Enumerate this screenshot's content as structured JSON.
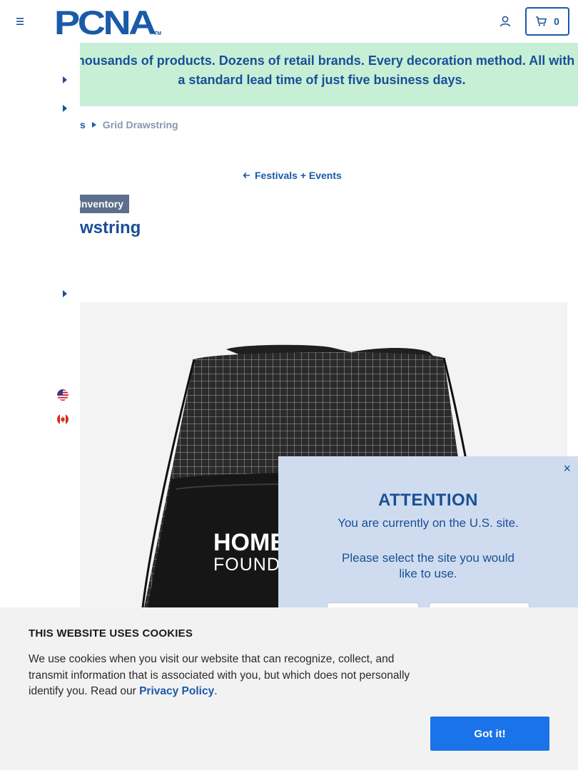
{
  "header": {
    "logo_text": "PCNA",
    "cart_count": "0"
  },
  "banner": {
    "text": "Thousands of products. Dozens of retail brands. Every decoration method. All with a standard lead time of just five business days."
  },
  "breadcrumb": {
    "prev": "s",
    "current": "Grid Drawstring"
  },
  "back_link": "Festivals + Events",
  "badge": "Inventory",
  "product_title": "wstring",
  "product_image": {
    "imprint_line1": "HOME",
    "imprint_line2": "FOUNDA"
  },
  "attention": {
    "close": "×",
    "title": "ATTENTION",
    "text1": "You are currently on the U.S. site.",
    "text2": "Please select the site you would like to use."
  },
  "cookie": {
    "title": "THIS WEBSITE USES COOKIES",
    "text": "We use cookies when you visit our website that can recognize, collect, and transmit information that is associated with you, but which does not personally identify you. Read our ",
    "link": "Privacy Policy",
    "period": ".",
    "button": "Got it!"
  },
  "colors": {
    "brand_blue": "#1a5aa8",
    "banner_green": "#c6efd6",
    "modal_bg": "#cfdcef",
    "cookie_button": "#1a73e8"
  },
  "icons": [
    "menu-icon",
    "user-icon",
    "cart-icon",
    "caret-right-icon",
    "arrow-left-icon",
    "us-flag-icon",
    "canada-flag-icon",
    "close-icon"
  ]
}
